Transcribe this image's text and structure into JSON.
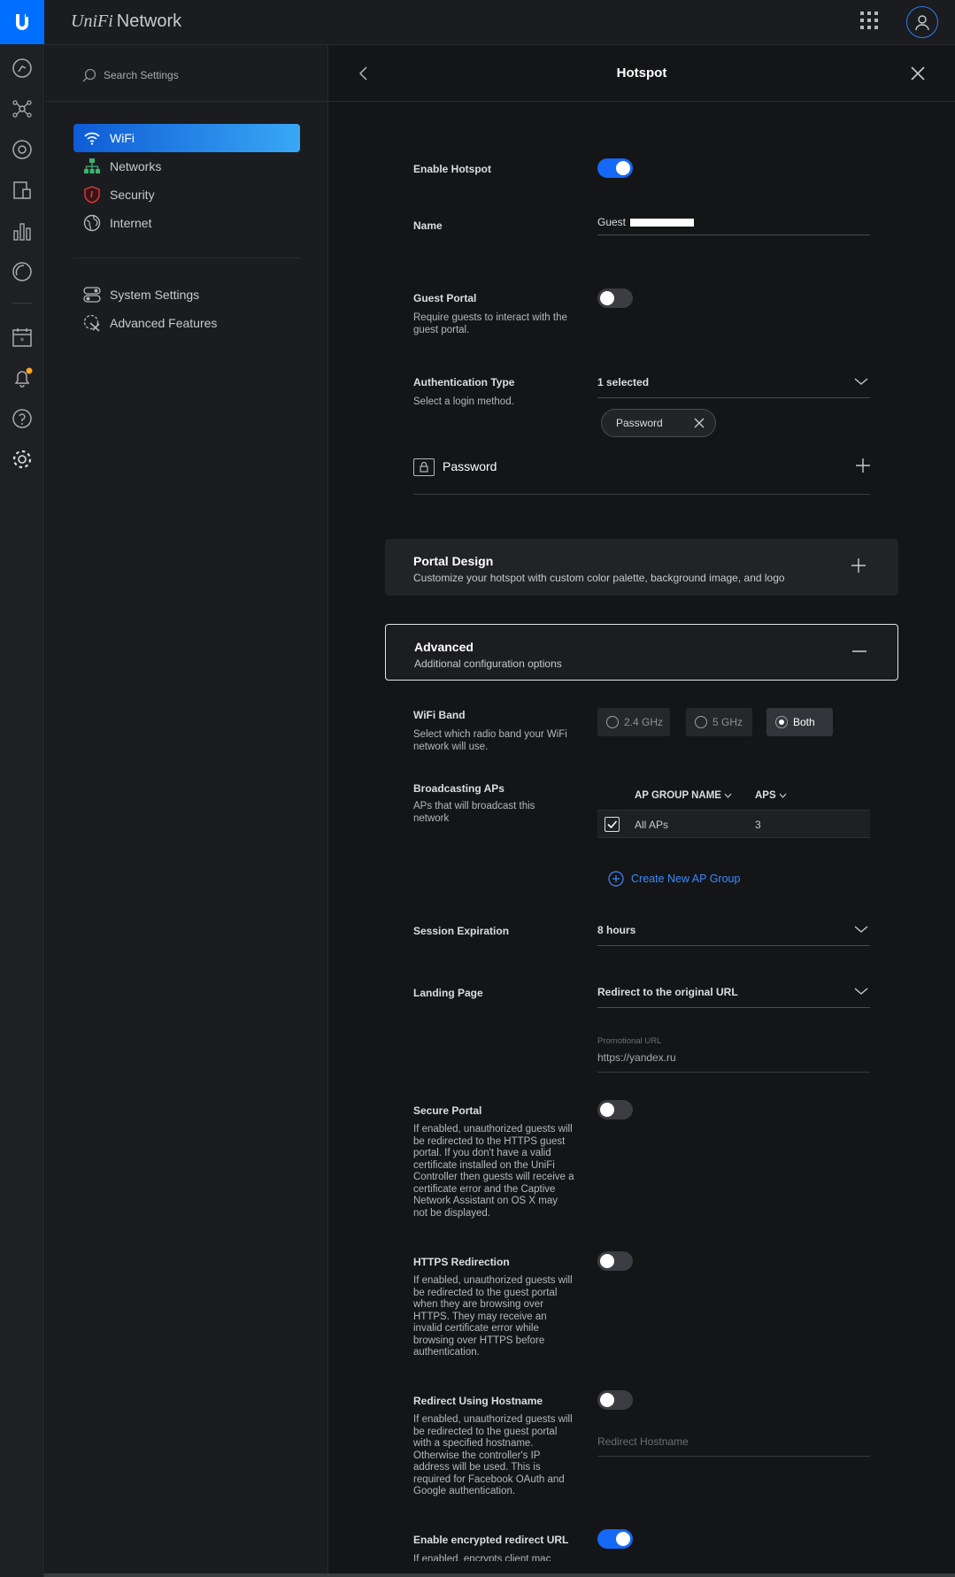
{
  "app": {
    "brand_prefix": "UniFi",
    "brand_suffix": "Network"
  },
  "nav": {
    "search_placeholder": "Search Settings",
    "items": [
      {
        "label": "WiFi",
        "icon": "wifi-icon",
        "active": true
      },
      {
        "label": "Networks",
        "icon": "network-icon"
      },
      {
        "label": "Security",
        "icon": "shield-icon"
      },
      {
        "label": "Internet",
        "icon": "globe-icon"
      },
      {
        "label": "System Settings",
        "icon": "toggles-icon"
      },
      {
        "label": "Advanced Features",
        "icon": "tools-icon"
      }
    ]
  },
  "panel": {
    "title": "Hotspot",
    "enable_hotspot": {
      "label": "Enable Hotspot",
      "on": true
    },
    "name": {
      "label": "Name",
      "value": "Guest"
    },
    "guest_portal": {
      "label": "Guest Portal",
      "desc": "Require guests to interact with the guest portal.",
      "on": false
    },
    "auth_type": {
      "label": "Authentication Type",
      "desc": "Select a login method.",
      "value": "1 selected",
      "chip": "Password"
    },
    "password_row": {
      "label": "Password"
    },
    "portal_design": {
      "title": "Portal Design",
      "desc": "Customize your hotspot with custom color palette, background image, and logo"
    },
    "advanced": {
      "title": "Advanced",
      "desc": "Additional configuration options"
    },
    "wifi_band": {
      "label": "WiFi Band",
      "desc": "Select which radio band your WiFi network will use.",
      "options": [
        "2.4 GHz",
        "5 GHz",
        "Both"
      ],
      "selected": "Both"
    },
    "broadcasting_aps": {
      "label": "Broadcasting APs",
      "desc": "APs that will broadcast this network",
      "columns": [
        "AP GROUP NAME",
        "APS"
      ],
      "rows": [
        {
          "name": "All APs",
          "aps": "3",
          "checked": true
        }
      ],
      "create_link": "Create New AP Group"
    },
    "session_expiration": {
      "label": "Session Expiration",
      "value": "8 hours"
    },
    "landing_page": {
      "label": "Landing Page",
      "value": "Redirect to the original URL",
      "promo_label": "Promotional URL",
      "promo_value": "https://yandex.ru"
    },
    "secure_portal": {
      "label": "Secure Portal",
      "desc": "If enabled, unauthorized guests will be redirected to the HTTPS guest portal. If you don't have a valid certificate installed on the UniFi Controller then guests will receive a certificate error and the Captive Network Assistant on OS X may not be displayed.",
      "on": false
    },
    "https_redirection": {
      "label": "HTTPS Redirection",
      "desc": "If enabled, unauthorized guests will be redirected to the guest portal when they are browsing over HTTPS. They may receive an invalid certificate error while browsing over HTTPS before authentication.",
      "on": false
    },
    "redirect_hostname": {
      "label": "Redirect Using Hostname",
      "desc": "If enabled, unauthorized guests will be redirected to the guest portal with a specified hostname. Otherwise the controller's IP address will be used. This is required for Facebook OAuth and Google authentication.",
      "placeholder": "Redirect Hostname",
      "on": false
    },
    "encrypted_redirect": {
      "label": "Enable encrypted redirect URL",
      "desc": "If enabled, encrypts client mac",
      "on": true
    }
  },
  "colors": {
    "accent": "#006fff",
    "toggle_on": "#1468f5",
    "link": "#3a8bff",
    "notification": "#f5a623"
  }
}
